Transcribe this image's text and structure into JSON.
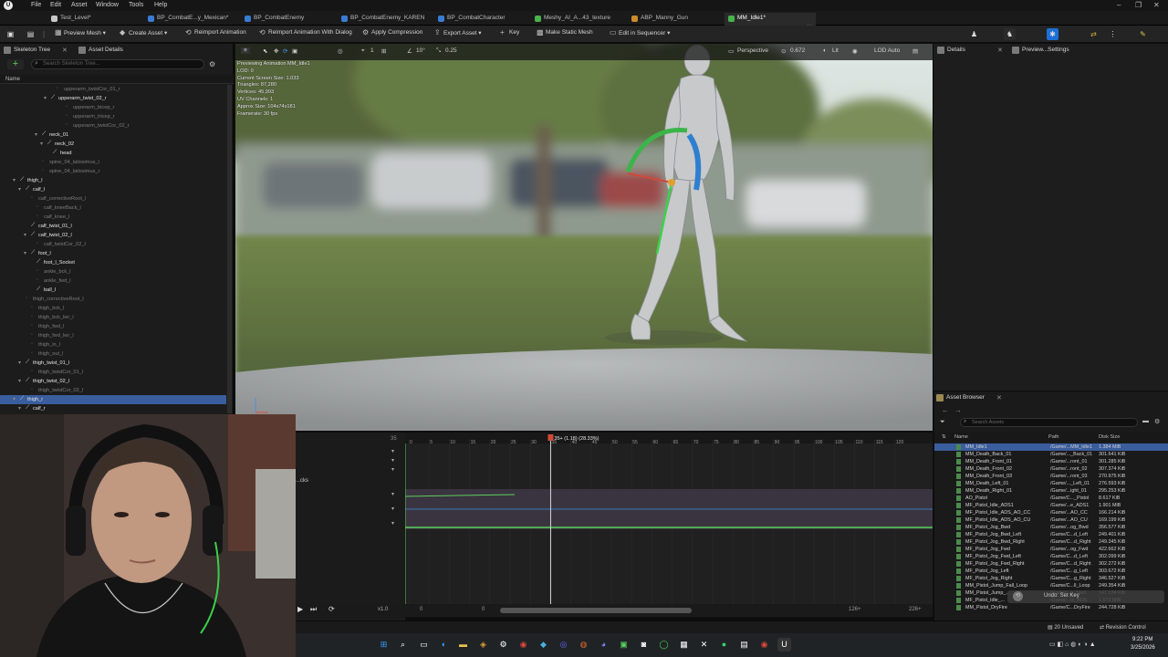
{
  "menu": {
    "items": [
      "File",
      "Edit",
      "Asset",
      "Window",
      "Tools",
      "Help"
    ]
  },
  "tabs": [
    {
      "label": "Test_Level*",
      "color": "#c8c8c8"
    },
    {
      "label": "BP_CombatE...y_Mexican*",
      "color": "#3a7bd5"
    },
    {
      "label": "BP_CombatEnemy",
      "color": "#3a7bd5"
    },
    {
      "label": "BP_CombatEnemy_KAREN",
      "color": "#3a7bd5"
    },
    {
      "label": "BP_CombatCharacter",
      "color": "#3a7bd5"
    },
    {
      "label": "Meshy_AI_A...43_texture",
      "color": "#49b24e"
    },
    {
      "label": "ABP_Manny_Gun",
      "color": "#c98a2b"
    },
    {
      "label": "MM_Idle1*",
      "color": "#49b24e"
    }
  ],
  "toolbar": {
    "preview_mesh": "Preview Mesh",
    "create_asset": "Create Asset",
    "reimport_animation": "Reimport Animation",
    "reimport_with_dialog": "Reimport Animation With Dialog",
    "apply_compression": "Apply Compression",
    "export_asset": "Export Asset",
    "key": "Key",
    "make_static_mesh": "Make Static Mesh",
    "edit_in_sequencer": "Edit in Sequencer"
  },
  "left_panel": {
    "tab_skeleton_tree": "Skeleton Tree",
    "tab_asset_details": "Asset Details",
    "search_placeholder": "Search Skeleton Tree...",
    "column_name": "Name",
    "tree": [
      {
        "label": "upperarm_twistCor_01_r",
        "indent": 62,
        "dim": true
      },
      {
        "label": "upperarm_twist_02_r",
        "indent": 56,
        "dim": false,
        "expander": true
      },
      {
        "label": "upperarm_bicep_r",
        "indent": 72,
        "dim": true
      },
      {
        "label": "upperarm_tricep_r",
        "indent": 72,
        "dim": true
      },
      {
        "label": "upperarm_twistCor_02_r",
        "indent": 72,
        "dim": true
      },
      {
        "label": "neck_01",
        "indent": 46,
        "dim": false,
        "expander": true
      },
      {
        "label": "neck_02",
        "indent": 52,
        "dim": false,
        "expander": true
      },
      {
        "label": "head",
        "indent": 58,
        "dim": false
      },
      {
        "label": "spine_04_latissimus_l",
        "indent": 46,
        "dim": true
      },
      {
        "label": "spine_04_latissimus_r",
        "indent": 46,
        "dim": true
      },
      {
        "label": "thigh_l",
        "indent": 22,
        "dim": false,
        "expander": true
      },
      {
        "label": "calf_l",
        "indent": 28,
        "dim": false,
        "expander": true
      },
      {
        "label": "calf_correctiveRoot_l",
        "indent": 34,
        "dim": true
      },
      {
        "label": "calf_kneeBack_l",
        "indent": 40,
        "dim": true
      },
      {
        "label": "calf_knee_l",
        "indent": 40,
        "dim": true
      },
      {
        "label": "calf_twist_01_l",
        "indent": 34,
        "dim": false
      },
      {
        "label": "calf_twist_02_l",
        "indent": 34,
        "dim": false,
        "expander": true
      },
      {
        "label": "calf_twistCor_02_l",
        "indent": 40,
        "dim": true
      },
      {
        "label": "foot_l",
        "indent": 34,
        "dim": false,
        "expander": true
      },
      {
        "label": "foot_l_Socket",
        "indent": 40,
        "dim": false
      },
      {
        "label": "ankle_bck_l",
        "indent": 40,
        "dim": true
      },
      {
        "label": "ankle_fwd_l",
        "indent": 40,
        "dim": true
      },
      {
        "label": "ball_l",
        "indent": 40,
        "dim": false
      },
      {
        "label": "thigh_correctiveRoot_l",
        "indent": 28,
        "dim": true
      },
      {
        "label": "thigh_bck_l",
        "indent": 34,
        "dim": true
      },
      {
        "label": "thigh_bck_lwr_l",
        "indent": 34,
        "dim": true
      },
      {
        "label": "thigh_fwd_l",
        "indent": 34,
        "dim": true
      },
      {
        "label": "thigh_fwd_lwr_l",
        "indent": 34,
        "dim": true
      },
      {
        "label": "thigh_in_l",
        "indent": 34,
        "dim": true
      },
      {
        "label": "thigh_out_l",
        "indent": 34,
        "dim": true
      },
      {
        "label": "thigh_twist_01_l",
        "indent": 28,
        "dim": false,
        "expander": true
      },
      {
        "label": "thigh_twistCor_01_l",
        "indent": 34,
        "dim": true
      },
      {
        "label": "thigh_twist_02_l",
        "indent": 28,
        "dim": false,
        "expander": true
      },
      {
        "label": "thigh_twistCor_02_l",
        "indent": 34,
        "dim": true
      },
      {
        "label": "thigh_r",
        "indent": 22,
        "dim": false,
        "expander": true,
        "selected": true
      },
      {
        "label": "calf_r",
        "indent": 28,
        "dim": false,
        "expander": true
      }
    ]
  },
  "viewport": {
    "perspective": "Perspective",
    "fov": "0.672",
    "lit": "Lit",
    "lod": "LOD Auto",
    "snap_rot": "10°",
    "snap_scale": "0.25",
    "grid_val": "1",
    "stats": [
      "Previewing Animation MM_Idle1",
      "LOD: 0",
      "Current Screen Size: 1.033",
      "Triangles: 87,280",
      "Vertices: 45,993",
      "UV Channels: 1",
      "Approx Size: 104x74x181",
      "Framerate: 30 fps"
    ]
  },
  "right_panel": {
    "tab_details": "Details",
    "tab_preview_settings": "Preview...Settings"
  },
  "asset_browser": {
    "tab": "Asset Browser",
    "search_placeholder": "Search Assets",
    "col_name": "Name",
    "col_path": "Path",
    "col_size": "Disk Size",
    "rows": [
      {
        "name": "MM_Idle1",
        "path": "/Game/...MM_Idle1",
        "size": "1.384 MiB",
        "selected": true
      },
      {
        "name": "MM_Death_Back_01",
        "path": "/Game/..._Back_01",
        "size": "301.641 KiB"
      },
      {
        "name": "MM_Death_Front_01",
        "path": "/Game/...ront_01",
        "size": "301.285 KiB"
      },
      {
        "name": "MM_Death_Front_02",
        "path": "/Game/...ront_02",
        "size": "307.374 KiB"
      },
      {
        "name": "MM_Death_Front_03",
        "path": "/Game/...ront_03",
        "size": "270.975 KiB"
      },
      {
        "name": "MM_Death_Left_01",
        "path": "/Game/..._Left_01",
        "size": "276.593 KiB"
      },
      {
        "name": "MM_Death_Right_01",
        "path": "/Game/...ight_01",
        "size": "295.253 KiB"
      },
      {
        "name": "AO_Pistol",
        "path": "/Game/C..._Pistol",
        "size": "8.617 KiB"
      },
      {
        "name": "MF_Pistol_Idle_ADS1",
        "path": "/Game/...e_ADS1",
        "size": "1.901 MiB"
      },
      {
        "name": "MF_Pistol_Idle_ADS_AO_CC",
        "path": "/Game/...AO_CC",
        "size": "166.214 KiB"
      },
      {
        "name": "MF_Pistol_Idle_ADS_AO_CU",
        "path": "/Game/...AO_CU",
        "size": "169.199 KiB"
      },
      {
        "name": "MF_Pistol_Jog_Bwd",
        "path": "/Game/...og_Bwd",
        "size": "356.577 KiB"
      },
      {
        "name": "MF_Pistol_Jog_Bwd_Left",
        "path": "/Game/C...d_Left",
        "size": "249.401 KiB"
      },
      {
        "name": "MF_Pistol_Jog_Bwd_Right",
        "path": "/Game/C...d_Right",
        "size": "249.345 KiB"
      },
      {
        "name": "MF_Pistol_Jog_Fwd",
        "path": "/Game/...og_Fwd",
        "size": "422.662 KiB"
      },
      {
        "name": "MF_Pistol_Jog_Fwd_Left",
        "path": "/Game/C...d_Left",
        "size": "302.099 KiB"
      },
      {
        "name": "MF_Pistol_Jog_Fwd_Right",
        "path": "/Game/C...d_Right",
        "size": "302.272 KiB"
      },
      {
        "name": "MF_Pistol_Jog_Left",
        "path": "/Game/C...g_Left",
        "size": "303.672 KiB"
      },
      {
        "name": "MF_Pistol_Jog_Right",
        "path": "/Game/C...g_Right",
        "size": "346.527 KiB"
      },
      {
        "name": "MM_Pistol_Jump_Fall_Loop",
        "path": "/Game/C...ll_Loop",
        "size": "249.354 KiB"
      },
      {
        "name": "MM_Pistol_Jump_...",
        "path": "/Game/...p_Start",
        "size": "147.134 KiB"
      },
      {
        "name": "MF_Pistol_Idle_...",
        "path": "/Game/...le_ADS",
        "size": "1.573 MiB"
      },
      {
        "name": "MM_Pistol_DryFire",
        "path": "/Game/C...DryFire",
        "size": "244.728 KiB"
      }
    ]
  },
  "timeline": {
    "frame_label": "35+ (1.18) (28.33%)",
    "frame_marker": "35",
    "playhead_frame": 35,
    "total_frames": 127,
    "ticks": [
      "0",
      "5",
      "10",
      "15",
      "20",
      "25",
      "30",
      "35",
      "40",
      "45",
      "50",
      "55",
      "60",
      "65",
      "70",
      "75",
      "80",
      "85",
      "90",
      "95",
      "100",
      "105",
      "110",
      "115",
      "120"
    ],
    "track_label": "...cks",
    "speed": "x1.0",
    "start": "0",
    "start2": "0",
    "end": "126+",
    "end2": "226+"
  },
  "tooltip": {
    "undo": "Undo: Set Key"
  },
  "status": {
    "unsaved": "20 Unsaved",
    "revision": "Revision Control"
  },
  "taskbar": {
    "time": "9:22 PM",
    "date": "3/25/2026"
  },
  "colors": {
    "accent": "#3a5d9e",
    "brand_green": "#5ad05a"
  }
}
